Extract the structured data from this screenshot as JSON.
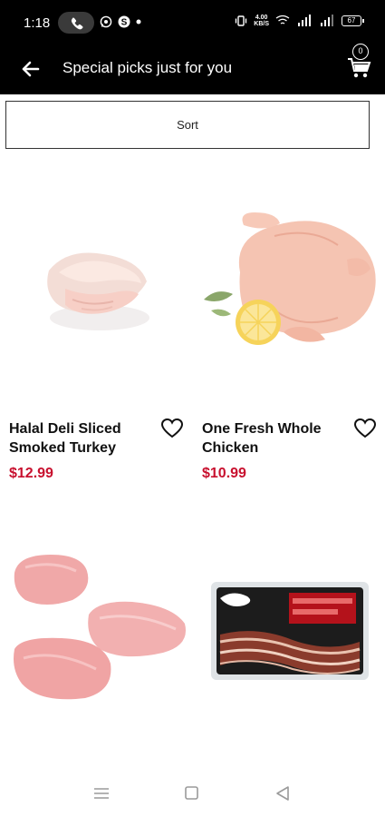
{
  "status": {
    "time": "1:18",
    "net_speed_top": "4.00",
    "net_speed_bottom": "KB/S",
    "battery": "67"
  },
  "header": {
    "title": "Special picks just for you",
    "cart_count": "0"
  },
  "sort": {
    "label": "Sort"
  },
  "products": [
    {
      "name": "Halal Deli Sliced Smoked Turkey",
      "price": "$12.99"
    },
    {
      "name": "One Fresh Whole Chicken",
      "price": "$10.99"
    },
    {
      "name": "",
      "price": ""
    },
    {
      "name": "",
      "price": ""
    }
  ],
  "colors": {
    "bar": "#000000",
    "price": "#c8102e",
    "accent_text": "#ffffff"
  },
  "icons": {
    "back": "arrow-left-icon",
    "cart": "cart-icon",
    "wishlist": "heart-outline-icon",
    "nav_menu": "menu-icon",
    "nav_home": "square-icon",
    "nav_back": "triangle-back-icon"
  }
}
